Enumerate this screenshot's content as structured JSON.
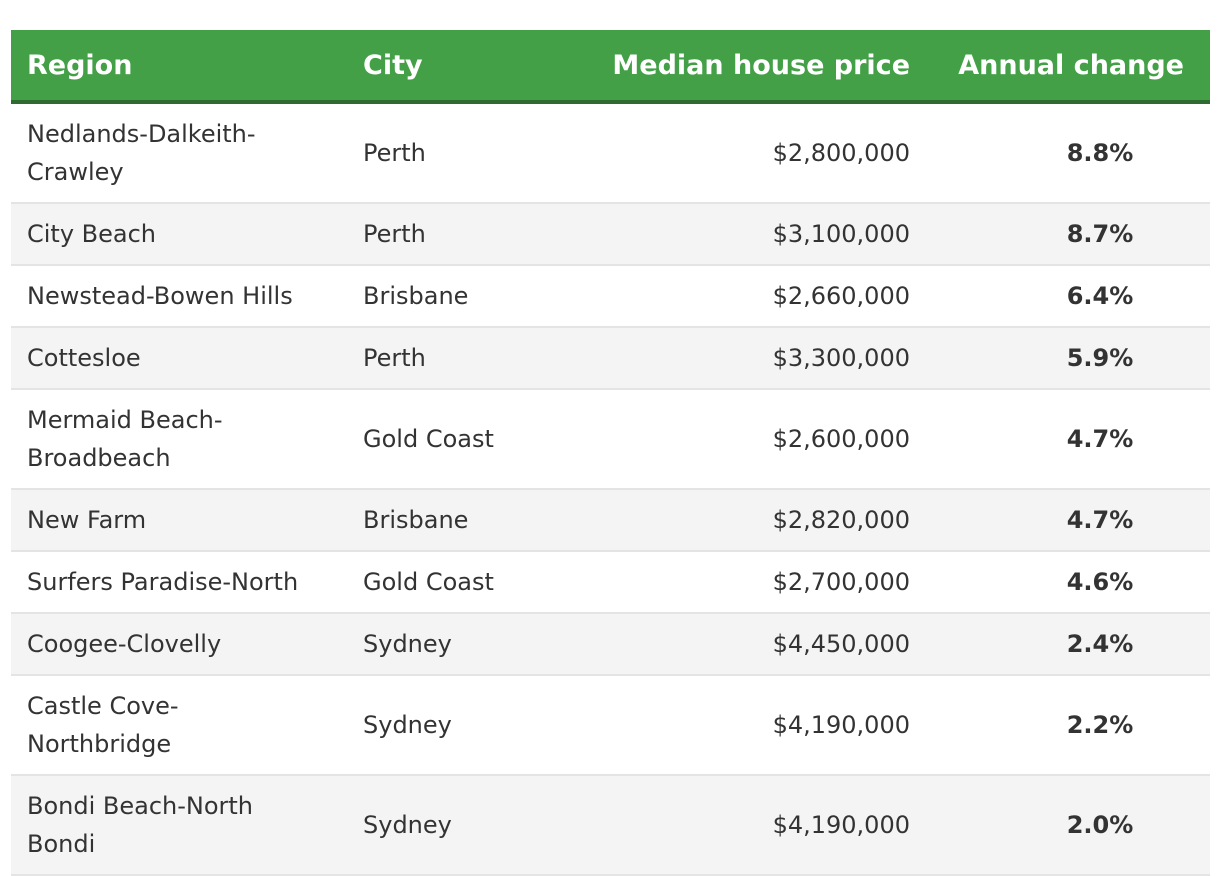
{
  "table": {
    "headers": [
      "Region",
      "City",
      "Median house price",
      "Annual change"
    ],
    "rows": [
      {
        "region": "Nedlands-Dalkeith-Crawley",
        "city": "Perth",
        "price": "$2,800,000",
        "change": "8.8%"
      },
      {
        "region": "City Beach",
        "city": "Perth",
        "price": "$3,100,000",
        "change": "8.7%"
      },
      {
        "region": "Newstead-Bowen Hills",
        "city": "Brisbane",
        "price": "$2,660,000",
        "change": "6.4%"
      },
      {
        "region": "Cottesloe",
        "city": "Perth",
        "price": "$3,300,000",
        "change": "5.9%"
      },
      {
        "region": "Mermaid Beach-Broadbeach",
        "city": "Gold Coast",
        "price": "$2,600,000",
        "change": "4.7%"
      },
      {
        "region": "New Farm",
        "city": "Brisbane",
        "price": "$2,820,000",
        "change": "4.7%"
      },
      {
        "region": "Surfers Paradise-North",
        "city": "Gold Coast",
        "price": "$2,700,000",
        "change": "4.6%"
      },
      {
        "region": "Coogee-Clovelly",
        "city": "Sydney",
        "price": "$4,450,000",
        "change": "2.4%"
      },
      {
        "region": "Castle Cove-Northbridge",
        "city": "Sydney",
        "price": "$4,190,000",
        "change": "2.2%"
      },
      {
        "region": "Bondi Beach-North Bondi",
        "city": "Sydney",
        "price": "$4,190,000",
        "change": "2.0%"
      }
    ]
  },
  "colors": {
    "header_bg": "#43a047",
    "header_text": "#ffffff"
  }
}
